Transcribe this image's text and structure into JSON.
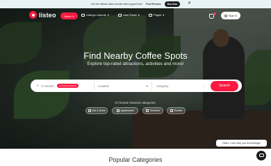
{
  "promo": {
    "text_before": "Get the official Listeo license with support from",
    "text_brand": "PureThemes",
    "buy_label": "Buy Now",
    "close_symbol": "✕"
  },
  "nav": {
    "logo_text": "listeo",
    "items": [
      {
        "label": "Home",
        "chevron": "▾",
        "icon": "house-icon"
      },
      {
        "label": "Listings Layouts",
        "chevron": "▾",
        "icon": "list-icon"
      },
      {
        "label": "User Panel",
        "chevron": "▾",
        "icon": "user-icon"
      },
      {
        "label": "Pages",
        "chevron": "▾",
        "icon": "pages-icon"
      }
    ],
    "cart_count": "0",
    "signin_label": "Sign In"
  },
  "hero": {
    "title": "Find Nearby Coffee Spots",
    "subtitle": "Explore top-rated attractions, activities and more!"
  },
  "search": {
    "keyword_placeholder": "AI Search",
    "ai_badge": "AI-Powered Search",
    "location_placeholder": "Location",
    "category_placeholder": "Category",
    "button_label": "Search"
  },
  "categories": {
    "intro": "Or browse featured categories:",
    "items": [
      {
        "label": "Eat & Drink",
        "icon": "food-icon"
      },
      {
        "label": "Apartments",
        "icon": "building-icon"
      },
      {
        "label": "Services",
        "icon": "gear-icon"
      },
      {
        "label": "Events",
        "icon": "calendar-icon"
      }
    ]
  },
  "help": {
    "bubble": "Hello! I can help you find listings!"
  },
  "section": {
    "title": "Popular Categories"
  },
  "colors": {
    "accent": "#f91942",
    "dark": "#1b1b1b"
  }
}
